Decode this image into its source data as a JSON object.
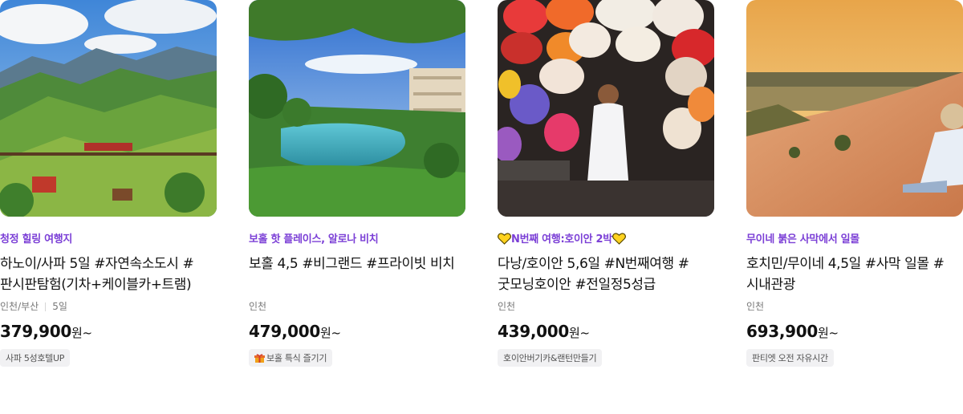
{
  "products": [
    {
      "tagline": "청정 힐링 여행지",
      "title": "하노이/사파 5일 #자연속소도시 #판시판탐험(기차+케이블카+트램)",
      "departure": "인천/부산",
      "duration": "5일",
      "price": "379,900",
      "price_unit": "원~",
      "badge": "사파 5성호텔UP",
      "image_icon": "mountain-landscape"
    },
    {
      "tagline": "보홀 핫 플레이스, 알로나 비치",
      "title": "보홀 4,5 #비그랜드 #프라이빗 비치",
      "departure": "인천",
      "price": "479,000",
      "price_unit": "원~",
      "badge": "보홀 특식 즐기기",
      "badge_icon": "gift-icon",
      "image_icon": "resort-pool"
    },
    {
      "tagline": "N번째 여행:호이안 2박",
      "tagline_icon": "yellow-heart",
      "title": "다낭/호이안 5,6일 #N번째여행 #굿모닝호이안 #전일정5성급",
      "departure": "인천",
      "price": "439,000",
      "price_unit": "원~",
      "badge": "호이안버기카&랜턴만들기",
      "image_icon": "lanterns"
    },
    {
      "tagline": "무이네 붉은 사막에서 일몰",
      "title": "호치민/무이네 4,5일 #사막 일몰 #시내관광",
      "departure": "인천",
      "price": "693,900",
      "price_unit": "원~",
      "badge": "판티엣 오전 자유시간",
      "image_icon": "desert-sunset"
    }
  ]
}
